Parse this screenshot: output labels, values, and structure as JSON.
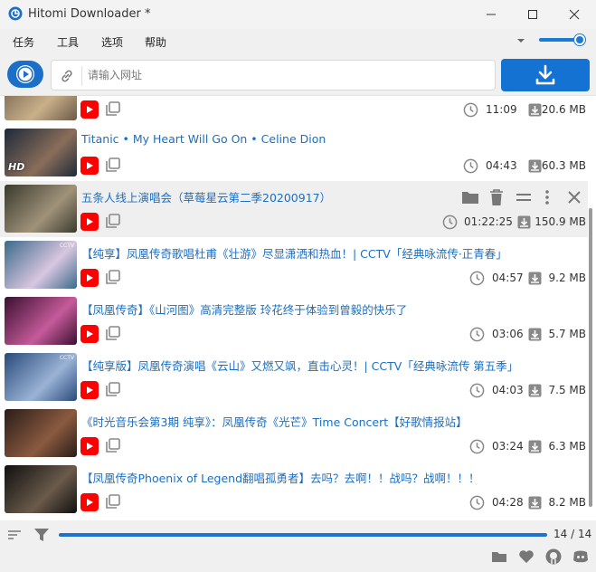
{
  "window": {
    "title": "Hitomi Downloader *"
  },
  "menu": {
    "items": [
      "任务",
      "工具",
      "选项",
      "帮助"
    ]
  },
  "url_bar": {
    "placeholder": "请输入网址",
    "value": ""
  },
  "volume": {
    "level": 0.9
  },
  "colors": {
    "accent": "#1473d2",
    "link": "#1a6fc4",
    "youtube": "#ff0000"
  },
  "downloads": [
    {
      "title": "",
      "duration": "11:09",
      "size": "20.6 MB",
      "thumb": [
        "#6b5a48",
        "#c9b08a"
      ]
    },
    {
      "title": "Titanic • My Heart Will Go On • Celine Dion",
      "duration": "04:43",
      "size": "60.3 MB",
      "thumb": [
        "#1d2a3a",
        "#8a6d5a"
      ],
      "badge": "HD"
    },
    {
      "title": "五条人线上演唱会（草莓星云第二季20200917）",
      "duration": "01:22:25",
      "size": "150.9 MB",
      "thumb": [
        "#3a3a2c",
        "#a0927a"
      ],
      "selected": true
    },
    {
      "title": "【纯享】凤凰传奇歌唱杜甫《壮游》尽显潇洒和热血！| CCTV「经典咏流传·正青春」",
      "duration": "04:57",
      "size": "9.2 MB",
      "thumb": [
        "#3a6a8a",
        "#d9c6e0"
      ],
      "badge": "CCTV"
    },
    {
      "title": "【凤凰传奇】《山河图》高清完整版  玲花终于体验到曾毅的快乐了",
      "duration": "03:06",
      "size": "5.7 MB",
      "thumb": [
        "#3a1030",
        "#c55a9a"
      ]
    },
    {
      "title": "【纯享版】凤凰传奇演唱《云山》又燃又飒，直击心灵！| CCTV「经典咏流传 第五季」",
      "duration": "04:03",
      "size": "7.5 MB",
      "thumb": [
        "#2a4a7a",
        "#9ab3d6"
      ],
      "badge": "CCTV"
    },
    {
      "title": "《时光音乐会第3期 纯享》：凤凰传奇《光芒》Time Concert【好歌情报站】",
      "duration": "03:24",
      "size": "6.3 MB",
      "thumb": [
        "#2a1c18",
        "#8a5a40"
      ]
    },
    {
      "title": "【凤凰传奇Phoenix of Legend翻唱孤勇者】去吗？去啊！！战吗？战啊！！！",
      "duration": "04:28",
      "size": "8.2 MB",
      "thumb": [
        "#101010",
        "#6a5a4a"
      ]
    }
  ],
  "status": {
    "count": "14 / 14",
    "progress": 1.0
  },
  "icons": {
    "play": "play-circle-icon",
    "link": "link-icon",
    "download": "download-icon",
    "youtube": "youtube-icon",
    "copy": "copy-icon",
    "clock": "clock-icon",
    "file": "file-download-icon",
    "folder": "folder-icon",
    "trash": "trash-icon",
    "menu": "menu-icon",
    "more": "more-vert-icon",
    "close": "close-icon",
    "sort": "sort-icon",
    "filter": "filter-icon",
    "heart": "heart-icon",
    "github": "github-icon",
    "discord": "discord-icon"
  }
}
